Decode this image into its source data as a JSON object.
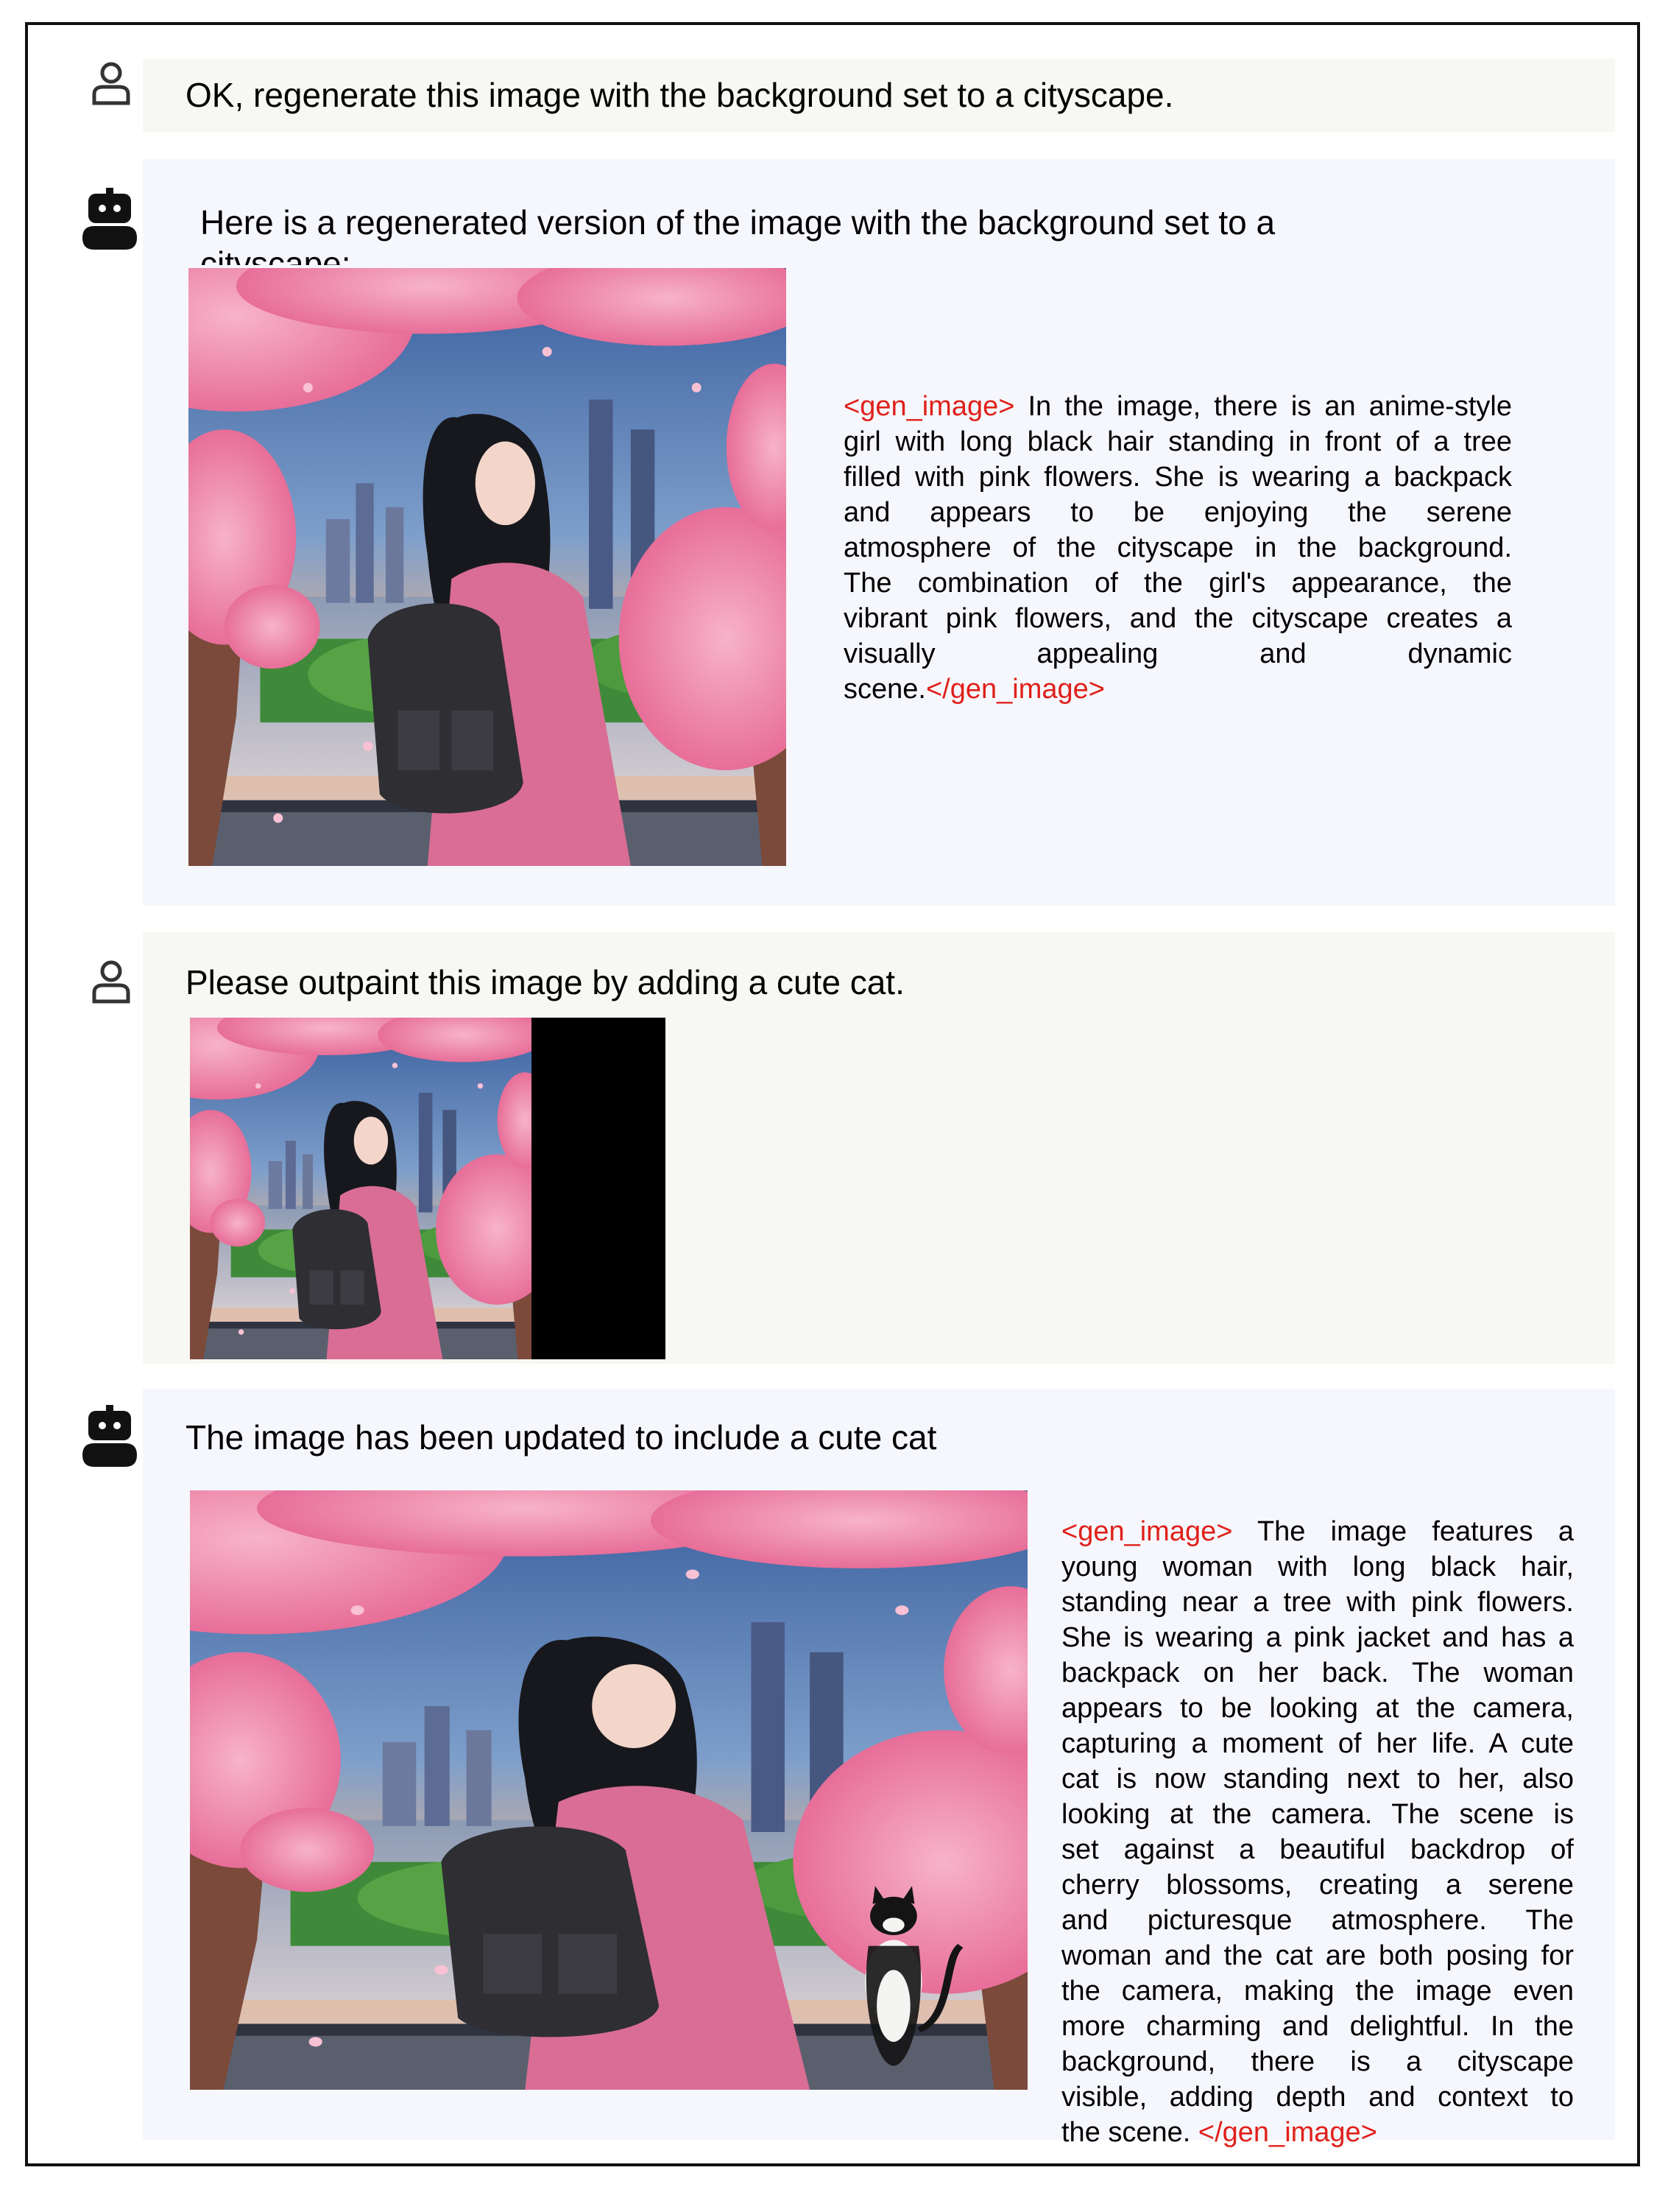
{
  "messages": [
    {
      "role": "user",
      "text": "OK, regenerate this image with the background set to a cityscape."
    },
    {
      "role": "assistant",
      "text": "Here is a regenerated version of the image with the background set to a cityscape:",
      "text_line1": "Here is a regenerated version of the image with the background set to a",
      "text_line2": "cityscape:",
      "tag_open": "<gen_image>",
      "tag_close": "</gen_image>",
      "caption_lines": [
        " In the image, there is an anime-style",
        "girl with long black hair standing in front of a tree",
        "filled with pink flowers. She is wearing a backpack",
        "and appears to be enjoying the serene",
        "atmosphere of the cityscape in the background.",
        "The combination of the girl's appearance, the",
        "vibrant pink flowers, and the cityscape creates a",
        "visually appealing and dynamic",
        "scene."
      ]
    },
    {
      "role": "user",
      "text": "Please outpaint this image by adding a cute cat."
    },
    {
      "role": "assistant",
      "text": "The image has been updated to include a cute cat",
      "tag_open": "<gen_image>",
      "tag_close": "</gen_image>",
      "caption_lines": [
        " The image features a",
        "young woman with long black hair,",
        "standing near a tree with pink flowers.",
        "She is wearing a pink jacket and has a",
        "backpack on her back. The woman",
        "appears to be looking at the camera,",
        "capturing a moment of her life. A cute",
        "cat is now standing next to her, also",
        "looking at the camera. The scene is",
        "set against a beautiful backdrop of",
        "cherry blossoms, creating a serene",
        "and picturesque atmosphere. The",
        "woman and the cat are both posing for",
        "the camera, making the image even",
        "more charming and delightful. In the",
        "background, there is a cityscape",
        "visible, adding depth and context to",
        "the scene. "
      ]
    }
  ],
  "icons": {
    "user": "user-icon",
    "assistant": "robot-icon"
  },
  "colors": {
    "tag": "#e0201b",
    "user_bg": "#f7f8f3",
    "bot_bg": "#f6f7fc",
    "border": "#111111"
  }
}
